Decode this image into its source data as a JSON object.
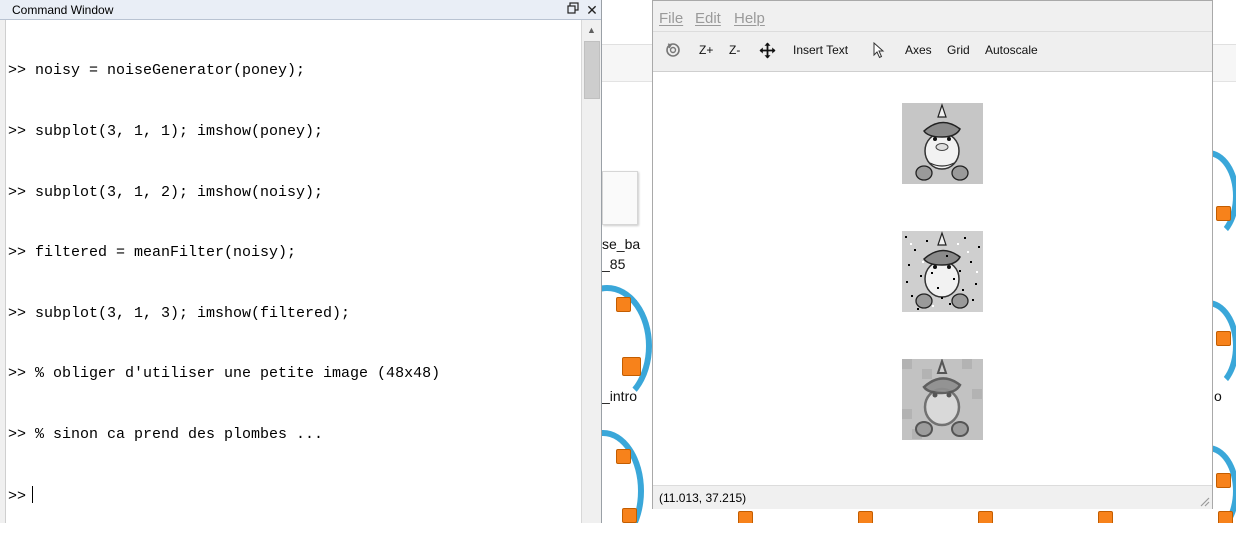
{
  "command_window": {
    "title": "Command Window",
    "lines": [
      ">> noisy = noiseGenerator(poney);",
      ">> subplot(3, 1, 1); imshow(poney);",
      ">> subplot(3, 1, 2); imshow(noisy);",
      ">> filtered = meanFilter(noisy);",
      ">> subplot(3, 1, 3); imshow(filtered);",
      ">> % obliger d'utiliser une petite image (48x48)",
      ">> % sinon ca prend des plombes ..."
    ],
    "prompt": ">>"
  },
  "background": {
    "labels": [
      "se_ba",
      "_85",
      "_intro",
      "o"
    ]
  },
  "figure": {
    "menu": [
      "File",
      "Edit",
      "Help"
    ],
    "toolbar": {
      "zoom_in": "Z+",
      "zoom_out": "Z-",
      "insert_text": "Insert Text",
      "axes": "Axes",
      "grid": "Grid",
      "autoscale": "Autoscale"
    },
    "status_coords": "(11.013, 37.215)",
    "icons": {
      "rotate": "rotate-icon",
      "pan": "pan-move-icon",
      "select": "select-pointer-icon"
    }
  }
}
